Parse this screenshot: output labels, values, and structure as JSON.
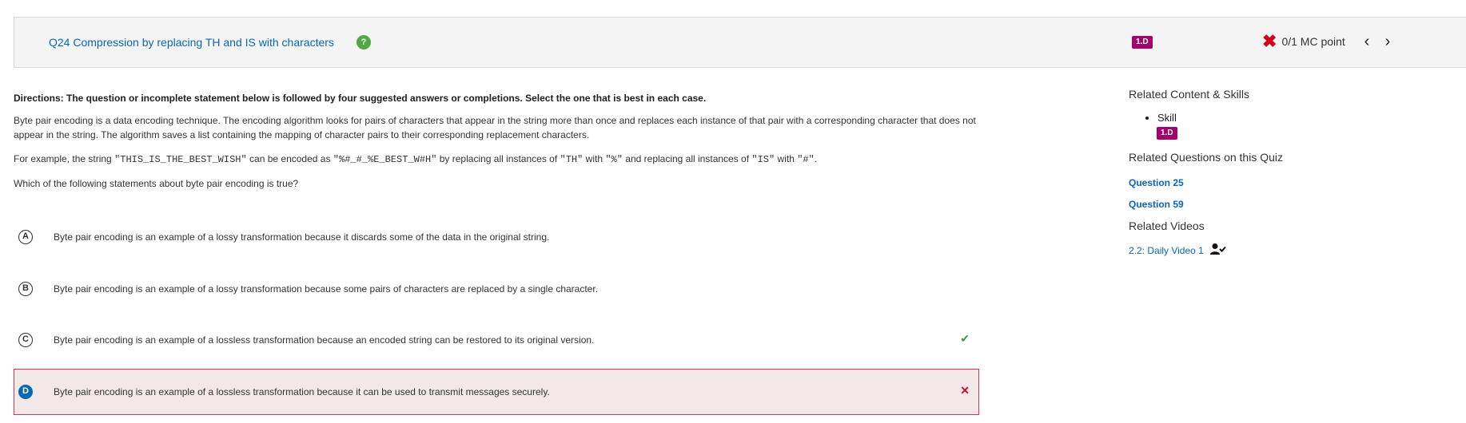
{
  "header": {
    "title": "Q24 Compression by replacing TH and IS with characters",
    "help_icon": "?",
    "skill_badge": "1.D",
    "score_icon": "✖",
    "score_text": "0/1 MC point",
    "prev_icon": "‹",
    "next_icon": "›"
  },
  "question": {
    "directions": "Directions: The question or incomplete statement below is followed by four suggested answers or completions. Select the one that is best in each case.",
    "paragraph1": "Byte pair encoding is a data encoding technique. The encoding algorithm looks for pairs of characters that appear in the string more than once and replaces each instance of that pair with a corresponding character that does not appear in the string. The algorithm saves a list containing the mapping of character pairs to their corresponding replacement characters.",
    "example": {
      "t1": "For example, the string ",
      "c1": "\"THIS_IS_THE_BEST_WISH\"",
      "t2": " can be encoded as ",
      "c2": "\"%#_#_%E_BEST_W#H\"",
      "t3": " by replacing all instances of ",
      "c3": "\"TH\"",
      "t4": " with ",
      "c4": "\"%\"",
      "t5": " and replacing all instances of ",
      "c5": "\"IS\"",
      "t6": " with ",
      "c6": "\"#\"",
      "t7": "."
    },
    "prompt": "Which of the following statements about byte pair encoding is true?"
  },
  "choices": [
    {
      "letter": "A",
      "text": "Byte pair encoding is an example of a lossy transformation because it discards some of the data in the original string.",
      "mark": ""
    },
    {
      "letter": "B",
      "text": "Byte pair encoding is an example of a lossy transformation because some pairs of characters are replaced by a single character.",
      "mark": ""
    },
    {
      "letter": "C",
      "text": "Byte pair encoding is an example of a lossless transformation because an encoded string can be restored to its original version.",
      "mark": "✔"
    },
    {
      "letter": "D",
      "text": "Byte pair encoding is an example of a lossless transformation because it can be used to transmit messages securely.",
      "mark": "✕"
    }
  ],
  "sidebar": {
    "related_content_heading": "Related Content & Skills",
    "skill_label": "Skill",
    "skill_badge": "1.D",
    "related_questions_heading": "Related Questions on this Quiz",
    "questions": [
      "Question 25",
      "Question 59"
    ],
    "related_videos_heading": "Related Videos",
    "video_link": "2.2: Daily Video 1"
  },
  "colors": {
    "accent_blue": "#0c66b7",
    "badge_magenta": "#a3006d",
    "wrong_red": "#c8102e",
    "correct_green": "#3a9a3a"
  }
}
